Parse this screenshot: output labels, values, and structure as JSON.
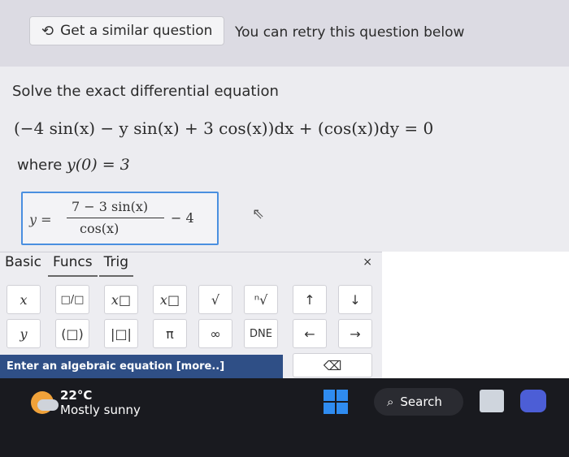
{
  "header": {
    "similar_label": "Get a similar question",
    "retry_text": "You can retry this question below"
  },
  "question": {
    "title": "Solve the exact differential equation",
    "equation": "(−4 sin(x) − y sin(x) + 3 cos(x))dx + (cos(x))dy = 0",
    "where_prefix": "where",
    "condition": "y(0) = 3"
  },
  "answer": {
    "lhs": "y =",
    "numerator": "7 − 3 sin(x)",
    "denominator": "cos(x)",
    "tail": "− 4"
  },
  "keyboard": {
    "tabs": [
      "Basic",
      "Funcs",
      "Trig"
    ],
    "close": "×",
    "row1": [
      "x",
      "□/□",
      "x□",
      "x□",
      "√",
      "ⁿ√",
      "↑",
      "↓"
    ],
    "row2": [
      "y",
      "(□)",
      "|□|",
      "π",
      "∞",
      "DNE",
      "←",
      "→"
    ],
    "backspace": "⌫",
    "hint": "Enter an algebraic equation [more..]"
  },
  "taskbar": {
    "temperature": "22°C",
    "condition": "Mostly sunny",
    "search_label": "Search"
  }
}
